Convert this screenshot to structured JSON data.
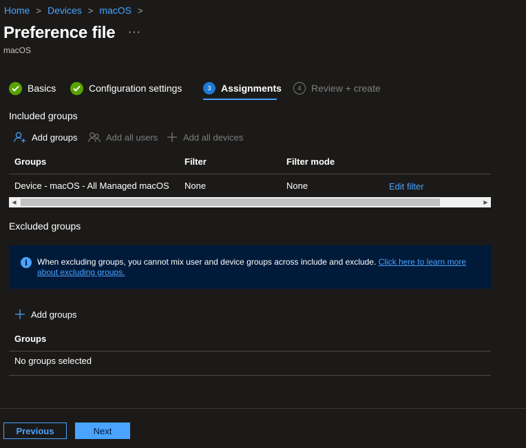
{
  "breadcrumb": {
    "items": [
      "Home",
      "Devices",
      "macOS"
    ],
    "separator": ">"
  },
  "page": {
    "title": "Preference file",
    "more": "···",
    "subtitle": "macOS"
  },
  "steps": [
    {
      "label": "Basics",
      "state": "completed"
    },
    {
      "label": "Configuration settings",
      "state": "completed"
    },
    {
      "label": "Assignments",
      "number": "3",
      "state": "active"
    },
    {
      "label": "Review + create",
      "number": "4",
      "state": "inactive"
    }
  ],
  "included": {
    "title": "Included groups",
    "commands": {
      "add_groups": "Add groups",
      "add_all_users": "Add all users",
      "add_all_devices": "Add all devices"
    },
    "columns": [
      "Groups",
      "Filter",
      "Filter mode"
    ],
    "rows": [
      {
        "group": "Device - macOS - All Managed macOS",
        "filter": "None",
        "filter_mode": "None",
        "action": "Edit filter"
      }
    ]
  },
  "excluded": {
    "title": "Excluded groups",
    "info_text": "When excluding groups, you cannot mix user and device groups across include and exclude. ",
    "info_link": "Click here to learn more about excluding groups.",
    "add_groups": "Add groups",
    "column": "Groups",
    "empty": "No groups selected"
  },
  "footer": {
    "previous": "Previous",
    "next": "Next"
  },
  "colors": {
    "background": "#1b1a19",
    "accent": "#4aa3ff",
    "success": "#57a300",
    "banner": "#001a3a"
  }
}
